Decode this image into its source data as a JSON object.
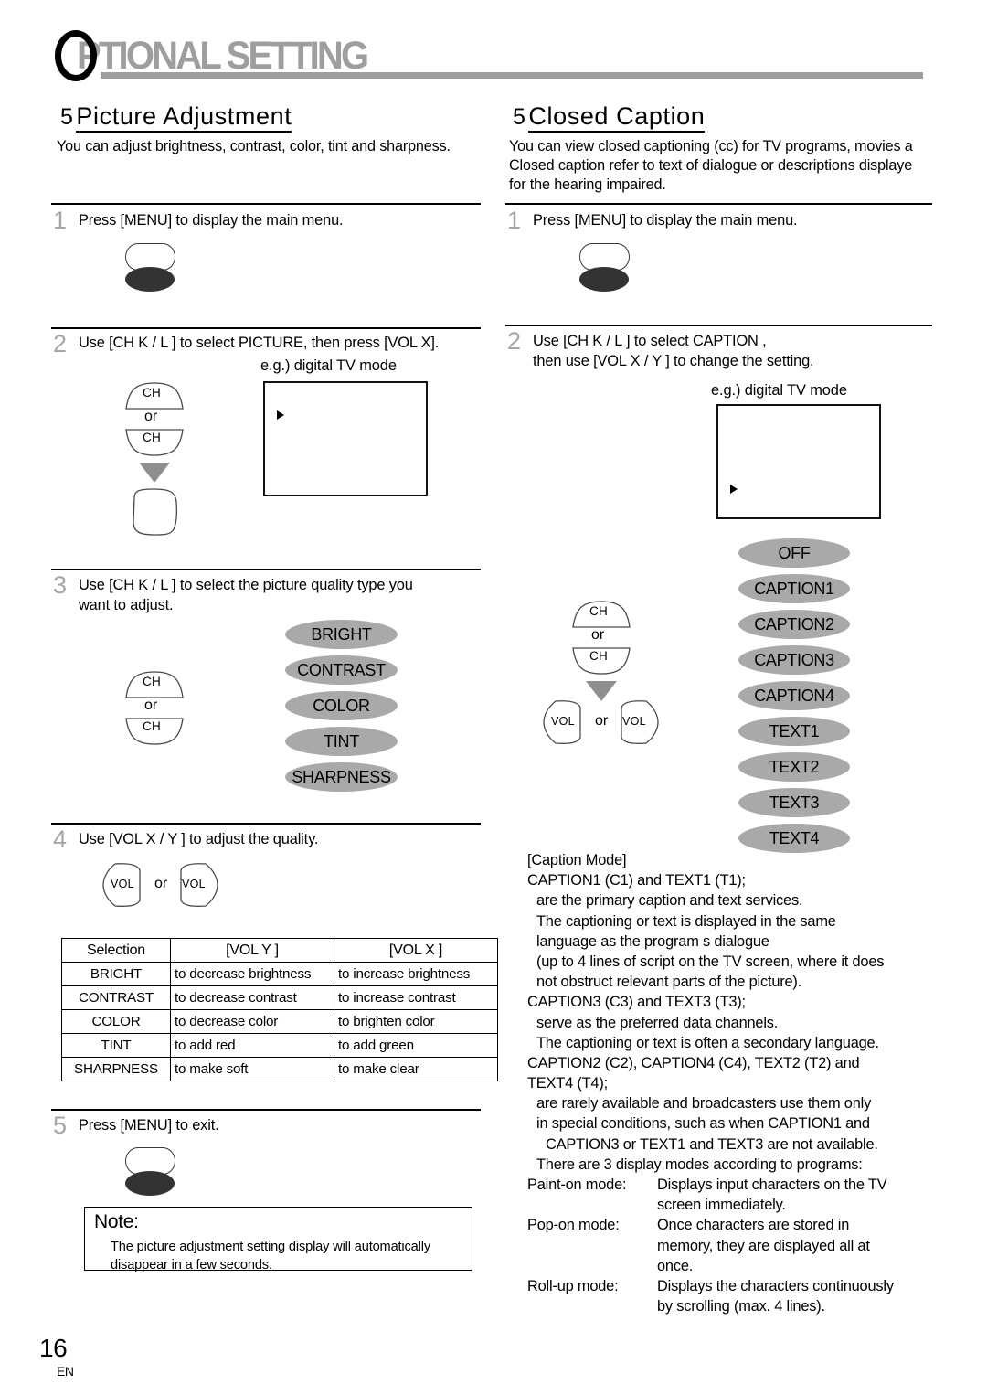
{
  "header": {
    "initial": "O",
    "rest": "PTIONAL SETTING"
  },
  "footer": {
    "page_number": "16",
    "region_code": "EN"
  },
  "left_column": {
    "section": {
      "number": "5",
      "title": "Picture Adjustment",
      "intro": "You can adjust brightness, contrast, color, tint and sharpness."
    },
    "steps": [
      {
        "number": "1",
        "text": "Press [MENU] to display the main menu."
      },
      {
        "number": "2",
        "text": "Use [CH K / L ] to select  PICTURE, then press [VOL X].",
        "example_label": "e.g.) digital TV mode"
      },
      {
        "number": "3",
        "text_line1": "Use [CH K / L ] to select the picture quality type you",
        "text_line2": "want to adjust."
      },
      {
        "number": "4",
        "text": "Use [VOL X / Y ] to adjust the quality."
      },
      {
        "number": "5",
        "text": "Press [MENU] to exit."
      }
    ],
    "keys": {
      "ch_label": "CH",
      "or_label": "or",
      "vol_label": "VOL"
    },
    "quality_options": [
      "BRIGHT",
      "CONTRAST",
      "COLOR",
      "TINT",
      "SHARPNESS"
    ],
    "table": {
      "headers": [
        "Selection",
        "[VOL Y ]",
        "[VOL X ]"
      ],
      "rows": [
        [
          "BRIGHT",
          "to decrease brightness",
          "to increase brightness"
        ],
        [
          "CONTRAST",
          "to decrease contrast",
          "to increase contrast"
        ],
        [
          "COLOR",
          "to decrease color",
          "to brighten color"
        ],
        [
          "TINT",
          "to add red",
          "to add green"
        ],
        [
          "SHARPNESS",
          "to make soft",
          "to make clear"
        ]
      ]
    },
    "note": {
      "title": "Note:",
      "line1": "The picture adjustment setting display will automatically",
      "line2": "disappear in a few seconds."
    }
  },
  "right_column": {
    "section": {
      "number": "5",
      "title": "Closed Caption",
      "intro_line1": "You can view closed captioning (cc) for TV programs, movies a",
      "intro_line2": "Closed caption refer to text of dialogue or descriptions displaye",
      "intro_line3": "for the hearing impaired."
    },
    "steps": [
      {
        "number": "1",
        "text": "Press [MENU] to display the main menu."
      },
      {
        "number": "2",
        "text_line1": "Use [CH K / L ] to select  CAPTION ,",
        "text_line2": "then use [VOL X / Y ] to change the setting.",
        "example_label": "e.g.) digital TV mode"
      }
    ],
    "keys": {
      "ch_label": "CH",
      "or_label": "or",
      "vol_label": "VOL"
    },
    "caption_options": [
      "OFF",
      "CAPTION1",
      "CAPTION2",
      "CAPTION3",
      "CAPTION4",
      "TEXT1",
      "TEXT2",
      "TEXT3",
      "TEXT4"
    ],
    "caption_mode": {
      "heading": "[Caption Mode]",
      "lines": [
        "CAPTION1 (C1) and TEXT1 (T1);",
        "are the primary caption and text services.",
        "The captioning or text is displayed in the same",
        "language as the program s dialogue",
        "(up to 4 lines of script on the TV screen, where it does",
        "not obstruct relevant parts of the picture).",
        "CAPTION3 (C3) and TEXT3 (T3);",
        "serve as the preferred data channels.",
        "The captioning or text is often a secondary language.",
        "CAPTION2 (C2), CAPTION4 (C4), TEXT2 (T2) and",
        "TEXT4 (T4);",
        "are rarely available and broadcasters use them only",
        "in special conditions, such as when  CAPTION1  and",
        "CAPTION3  or  TEXT1  and  TEXT3  are not available.",
        "There are 3 display modes according to programs:"
      ]
    },
    "display_modes": [
      {
        "name": "Paint-on mode:",
        "desc_line1": "Displays input characters on the TV",
        "desc_line2": "screen immediately.",
        "desc_line3": ""
      },
      {
        "name": "Pop-on mode:",
        "desc_line1": "Once characters are stored in",
        "desc_line2": "memory, they are displayed all at",
        "desc_line3": "once."
      },
      {
        "name": "Roll-up mode:",
        "desc_line1": "Displays the characters continuously",
        "desc_line2": "by scrolling (max. 4 lines).",
        "desc_line3": ""
      }
    ]
  }
}
